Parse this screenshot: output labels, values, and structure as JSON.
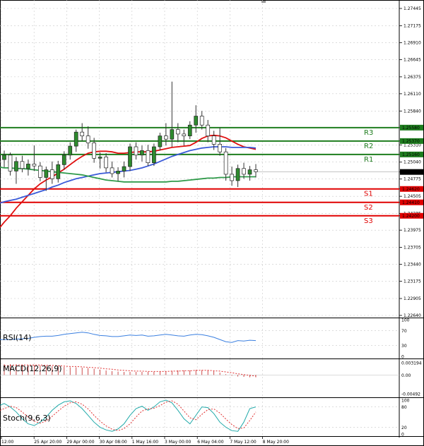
{
  "colors": {
    "background": "#ffffff",
    "grid": "#c8c8c8",
    "bull_candle": "#2e8b2e",
    "bear_candle": "#5a5a5a",
    "resistance": "#1e7d1e",
    "support": "#e00000",
    "ma_fast": "#e01010",
    "ma_slow": "#3a5ad8",
    "ma_green": "#2f9a4a",
    "rsi_line": "#3a7fe0",
    "macd_hist": "#c02020",
    "macd_signal": "#e03030",
    "stoch_main": "#22aaaa",
    "stoch_signal": "#e03030",
    "current_price_bg": "#000000"
  },
  "chart_data": [
    {
      "type": "candlestick",
      "panel": "price",
      "title": "",
      "xlabel": "",
      "ylabel": "",
      "ylim": [
        1.2264,
        1.27445
      ],
      "y_ticks": [
        "1.27445",
        "1.27175",
        "1.26910",
        "1.26645",
        "1.26375",
        "1.26110",
        "1.25840",
        "1.25580",
        "1.25370",
        "1.25310",
        "1.25160",
        "1.25040",
        "1.24886",
        "1.24775",
        "1.24620",
        "1.24505",
        "1.24410",
        "1.24235",
        "1.24200",
        "1.23975",
        "1.23705",
        "1.23440",
        "1.23175",
        "1.22905",
        "1.22640"
      ],
      "x_ticks": [
        "12:00",
        "25 Apr 20:00",
        "29 Apr 00:00",
        "30 Apr 08:00",
        "1 May 16:00",
        "3 May 00:00",
        "6 May 04:00",
        "7 May 12:00",
        "8 May 20:00"
      ],
      "grid": true,
      "candles": [
        {
          "o": 1.2508,
          "h": 1.2522,
          "l": 1.2496,
          "c": 1.2515
        },
        {
          "o": 1.2515,
          "h": 1.2519,
          "l": 1.2483,
          "c": 1.249
        },
        {
          "o": 1.249,
          "h": 1.2512,
          "l": 1.247,
          "c": 1.2505
        },
        {
          "o": 1.2505,
          "h": 1.2514,
          "l": 1.2488,
          "c": 1.2494
        },
        {
          "o": 1.2494,
          "h": 1.2508,
          "l": 1.2483,
          "c": 1.2501
        },
        {
          "o": 1.2501,
          "h": 1.253,
          "l": 1.249,
          "c": 1.2498
        },
        {
          "o": 1.2498,
          "h": 1.2504,
          "l": 1.2474,
          "c": 1.248
        },
        {
          "o": 1.248,
          "h": 1.2497,
          "l": 1.2459,
          "c": 1.2492
        },
        {
          "o": 1.2492,
          "h": 1.2505,
          "l": 1.247,
          "c": 1.2478
        },
        {
          "o": 1.2478,
          "h": 1.2506,
          "l": 1.2472,
          "c": 1.25
        },
        {
          "o": 1.25,
          "h": 1.2521,
          "l": 1.2492,
          "c": 1.2515
        },
        {
          "o": 1.2515,
          "h": 1.2535,
          "l": 1.2508,
          "c": 1.2529
        },
        {
          "o": 1.2529,
          "h": 1.2555,
          "l": 1.252,
          "c": 1.2551
        },
        {
          "o": 1.2551,
          "h": 1.2565,
          "l": 1.2537,
          "c": 1.2545
        },
        {
          "o": 1.2545,
          "h": 1.256,
          "l": 1.2525,
          "c": 1.2534
        },
        {
          "o": 1.2534,
          "h": 1.2542,
          "l": 1.2503,
          "c": 1.251
        },
        {
          "o": 1.251,
          "h": 1.2519,
          "l": 1.2494,
          "c": 1.2512
        },
        {
          "o": 1.2512,
          "h": 1.2518,
          "l": 1.2488,
          "c": 1.2495
        },
        {
          "o": 1.2495,
          "h": 1.2505,
          "l": 1.248,
          "c": 1.2486
        },
        {
          "o": 1.2486,
          "h": 1.2496,
          "l": 1.2474,
          "c": 1.249
        },
        {
          "o": 1.249,
          "h": 1.2505,
          "l": 1.248,
          "c": 1.2497
        },
        {
          "o": 1.2497,
          "h": 1.2533,
          "l": 1.249,
          "c": 1.2528
        },
        {
          "o": 1.2528,
          "h": 1.2535,
          "l": 1.2508,
          "c": 1.2515
        },
        {
          "o": 1.2515,
          "h": 1.253,
          "l": 1.2505,
          "c": 1.2522
        },
        {
          "o": 1.2522,
          "h": 1.2531,
          "l": 1.2498,
          "c": 1.2503
        },
        {
          "o": 1.2503,
          "h": 1.2533,
          "l": 1.2498,
          "c": 1.2528
        },
        {
          "o": 1.2528,
          "h": 1.255,
          "l": 1.2522,
          "c": 1.2545
        },
        {
          "o": 1.2545,
          "h": 1.2565,
          "l": 1.253,
          "c": 1.254
        },
        {
          "o": 1.254,
          "h": 1.263,
          "l": 1.2528,
          "c": 1.2555
        },
        {
          "o": 1.2555,
          "h": 1.2565,
          "l": 1.2535,
          "c": 1.2548
        },
        {
          "o": 1.2548,
          "h": 1.2555,
          "l": 1.253,
          "c": 1.2545
        },
        {
          "o": 1.2545,
          "h": 1.2568,
          "l": 1.254,
          "c": 1.2562
        },
        {
          "o": 1.2562,
          "h": 1.2593,
          "l": 1.255,
          "c": 1.2576
        },
        {
          "o": 1.2576,
          "h": 1.2584,
          "l": 1.2555,
          "c": 1.2562
        },
        {
          "o": 1.2562,
          "h": 1.257,
          "l": 1.2535,
          "c": 1.2545
        },
        {
          "o": 1.2545,
          "h": 1.2553,
          "l": 1.2523,
          "c": 1.2532
        },
        {
          "o": 1.2532,
          "h": 1.2558,
          "l": 1.2514,
          "c": 1.252
        },
        {
          "o": 1.252,
          "h": 1.2526,
          "l": 1.2475,
          "c": 1.2485
        },
        {
          "o": 1.2485,
          "h": 1.2497,
          "l": 1.2467,
          "c": 1.2475
        },
        {
          "o": 1.2475,
          "h": 1.25,
          "l": 1.2465,
          "c": 1.2494
        },
        {
          "o": 1.2494,
          "h": 1.2503,
          "l": 1.2478,
          "c": 1.2485
        },
        {
          "o": 1.2485,
          "h": 1.2498,
          "l": 1.2475,
          "c": 1.2492
        },
        {
          "o": 1.2492,
          "h": 1.2501,
          "l": 1.248,
          "c": 1.2489
        }
      ],
      "series": [
        {
          "kind": "ma_fast",
          "values": [
            1.241,
            1.242,
            1.2432,
            1.2442,
            1.2452,
            1.2462,
            1.247,
            1.2476,
            1.2481,
            1.2487,
            1.2493,
            1.25,
            1.2507,
            1.2513,
            1.2518,
            1.252,
            1.2521,
            1.2521,
            1.252,
            1.2518,
            1.2518,
            1.2519,
            1.252,
            1.252,
            1.252,
            1.2521,
            1.2523,
            1.2525,
            1.2527,
            1.2528,
            1.2529,
            1.253,
            1.2535,
            1.2541,
            1.2545,
            1.2546,
            1.2545,
            1.2542,
            1.2537,
            1.2532,
            1.2528,
            1.2526,
            1.2524
          ]
        },
        {
          "kind": "ma_slow",
          "values": [
            1.2442,
            1.2444,
            1.2446,
            1.2449,
            1.2452,
            1.2455,
            1.2458,
            1.2461,
            1.2465,
            1.2468,
            1.2472,
            1.2475,
            1.2478,
            1.248,
            1.2482,
            1.2484,
            1.2486,
            1.2487,
            1.2488,
            1.2489,
            1.249,
            1.2491,
            1.2493,
            1.2495,
            1.2498,
            1.2501,
            1.2505,
            1.2509,
            1.2513,
            1.2516,
            1.2519,
            1.2522,
            1.2524,
            1.2526,
            1.2527,
            1.2528,
            1.2528,
            1.2528,
            1.2527,
            1.2527,
            1.2527,
            1.2527,
            1.2526
          ]
        },
        {
          "kind": "ma_green",
          "values": [
            1.2495,
            1.2495,
            1.2494,
            1.2494,
            1.2493,
            1.2492,
            1.2491,
            1.249,
            1.2489,
            1.2488,
            1.2487,
            1.2486,
            1.2485,
            1.2484,
            1.2482,
            1.248,
            1.2478,
            1.2476,
            1.2475,
            1.2474,
            1.2473,
            1.2473,
            1.2473,
            1.2473,
            1.2473,
            1.2473,
            1.2473,
            1.2473,
            1.2474,
            1.2474,
            1.2475,
            1.2476,
            1.2477,
            1.2478,
            1.2479,
            1.2479,
            1.248,
            1.248,
            1.2481,
            1.2481,
            1.2481,
            1.2481,
            1.2481
          ]
        }
      ],
      "levels": [
        {
          "label": "R3",
          "value": 1.2558,
          "value_text": "1.25580",
          "kind": "resistance"
        },
        {
          "label": "R2",
          "value": 1.2537,
          "value_text": "1.25370",
          "kind": "resistance"
        },
        {
          "label": "R1",
          "value": 1.2516,
          "value_text": "1.25160",
          "kind": "resistance"
        },
        {
          "label": "S1",
          "value": 1.2462,
          "value_text": "1.24620",
          "kind": "support"
        },
        {
          "label": "S2",
          "value": 1.2441,
          "value_text": "1.24410",
          "kind": "support"
        },
        {
          "label": "S3",
          "value": 1.242,
          "value_text": "1.24200",
          "kind": "support"
        }
      ],
      "current_price": {
        "value": 1.24886,
        "text": "1.24886"
      }
    },
    {
      "type": "line",
      "panel": "rsi",
      "title": "RSI(14)",
      "ylim": [
        0,
        100
      ],
      "y_ticks": [
        "100",
        "70",
        "30",
        "0"
      ],
      "grid": true,
      "series": [
        {
          "name": "RSI(14)",
          "values": [
            46,
            46,
            47,
            48,
            49,
            52,
            54,
            55,
            55,
            57,
            60,
            62,
            64,
            66,
            64,
            60,
            57,
            56,
            54,
            54,
            56,
            58,
            57,
            58,
            55,
            56,
            58,
            60,
            58,
            56,
            55,
            58,
            60,
            59,
            56,
            52,
            46,
            40,
            38,
            43,
            42,
            44,
            43
          ]
        }
      ]
    },
    {
      "type": "bar",
      "panel": "macd",
      "title": "MACD(12,26,9)",
      "y_ticks": [
        "0.003194",
        "0.00",
        "-0.00492"
      ],
      "ylim": [
        -0.00492,
        0.003194
      ],
      "grid": true,
      "series": [
        {
          "name": "histogram",
          "values": [
            0.0028,
            0.0028,
            0.0027,
            0.0027,
            0.0026,
            0.0026,
            0.0025,
            0.0024,
            0.0023,
            0.0022,
            0.0021,
            0.002,
            0.002,
            0.0019,
            0.0018,
            0.0016,
            0.0014,
            0.0012,
            0.001,
            0.0009,
            0.0008,
            0.0008,
            0.0008,
            0.0008,
            0.0008,
            0.0008,
            0.0009,
            0.001,
            0.0011,
            0.0012,
            0.0012,
            0.0012,
            0.0013,
            0.0013,
            0.0012,
            0.001,
            0.0006,
            0.0002,
            -0.0002,
            -0.0004,
            -0.0005,
            -0.0006,
            -0.0006
          ]
        },
        {
          "name": "signal",
          "values": [
            0.0024,
            0.0025,
            0.0026,
            0.0026,
            0.0026,
            0.0026,
            0.0026,
            0.0025,
            0.0025,
            0.0024,
            0.0023,
            0.0022,
            0.0022,
            0.0021,
            0.002,
            0.0019,
            0.0018,
            0.0016,
            0.0015,
            0.0013,
            0.0012,
            0.0011,
            0.001,
            0.001,
            0.0009,
            0.0009,
            0.0009,
            0.0009,
            0.001,
            0.001,
            0.0011,
            0.0011,
            0.0012,
            0.0012,
            0.0012,
            0.0011,
            0.001,
            0.0008,
            0.0006,
            0.0003,
            0.0001,
            -0.0001,
            -0.0003
          ]
        }
      ]
    },
    {
      "type": "line",
      "panel": "stoch",
      "title": "Stoch(9,6,3)",
      "ylim": [
        0,
        100
      ],
      "y_ticks": [
        "100",
        "80",
        "20",
        "0"
      ],
      "grid": true,
      "series": [
        {
          "name": "main",
          "values": [
            90,
            80,
            65,
            45,
            30,
            25,
            35,
            50,
            70,
            85,
            95,
            98,
            90,
            75,
            55,
            35,
            20,
            12,
            8,
            15,
            30,
            55,
            75,
            82,
            70,
            80,
            95,
            100,
            92,
            70,
            45,
            30,
            55,
            80,
            78,
            60,
            35,
            20,
            10,
            8,
            35,
            75,
            80
          ]
        },
        {
          "name": "signal",
          "values": [
            75,
            82,
            78,
            65,
            50,
            38,
            32,
            38,
            52,
            68,
            82,
            92,
            95,
            88,
            74,
            55,
            38,
            24,
            14,
            10,
            16,
            30,
            50,
            68,
            74,
            76,
            84,
            94,
            98,
            88,
            68,
            48,
            42,
            58,
            72,
            74,
            62,
            44,
            28,
            16,
            18,
            40,
            65
          ]
        }
      ]
    }
  ]
}
